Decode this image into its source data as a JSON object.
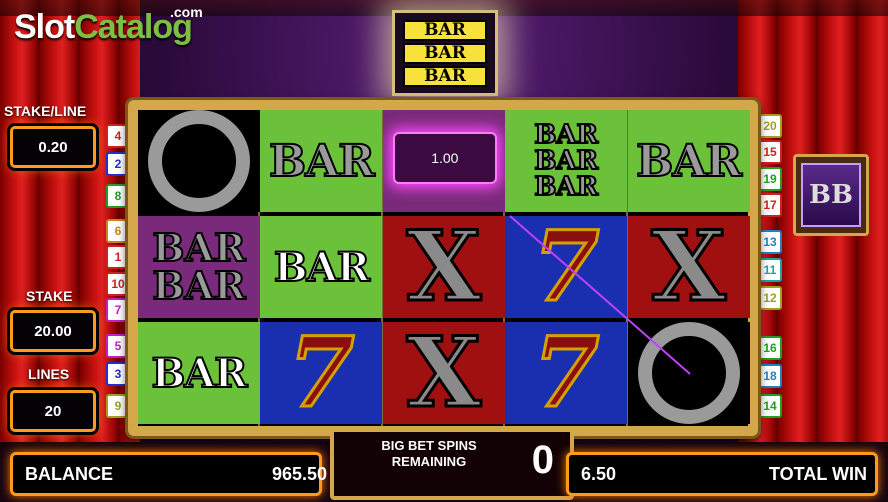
{
  "logo": {
    "part1": "Slot",
    "part2": "Catalog",
    "suffix": ".com"
  },
  "top_symbol": [
    "BAR",
    "BAR",
    "BAR"
  ],
  "left_panel": {
    "stake_line_label": "STAKE/LINE",
    "stake_line_value": "0.20",
    "stake_label": "STAKE",
    "stake_value": "20.00",
    "lines_label": "LINES",
    "lines_value": "20"
  },
  "paylines_left": [
    {
      "n": "4",
      "color": "#d02020"
    },
    {
      "n": "2",
      "color": "#2030d0"
    },
    {
      "n": "8",
      "color": "#20a020"
    },
    {
      "n": "6",
      "color": "#d08020"
    },
    {
      "n": "1",
      "color": "#d02020"
    },
    {
      "n": "10",
      "color": "#d02020"
    },
    {
      "n": "7",
      "color": "#c020c0"
    },
    {
      "n": "5",
      "color": "#c020c0"
    },
    {
      "n": "3",
      "color": "#2030d0"
    },
    {
      "n": "9",
      "color": "#a0a020"
    }
  ],
  "paylines_right": [
    {
      "n": "20",
      "color": "#a0a020"
    },
    {
      "n": "15",
      "color": "#d02020"
    },
    {
      "n": "19",
      "color": "#20a020"
    },
    {
      "n": "17",
      "color": "#d02020"
    },
    {
      "n": "13",
      "color": "#2080c0"
    },
    {
      "n": "11",
      "color": "#20a0a0"
    },
    {
      "n": "12",
      "color": "#a0a020"
    },
    {
      "n": "16",
      "color": "#20a020"
    },
    {
      "n": "18",
      "color": "#2080c0"
    },
    {
      "n": "14",
      "color": "#20a020"
    }
  ],
  "reels": {
    "win_amount": "1.00",
    "bar": "BAR"
  },
  "balance": {
    "label": "BALANCE",
    "value": "965.50"
  },
  "total_win": {
    "label": "TOTAL WIN",
    "value": "6.50"
  },
  "big_bet": {
    "label": "BIG BET SPINS REMAINING",
    "value": "0"
  },
  "colors": {
    "accent_orange": "#ff9a1a",
    "reel_gold": "#d4a84a"
  },
  "icons": {
    "big_bet_button": "BB"
  }
}
